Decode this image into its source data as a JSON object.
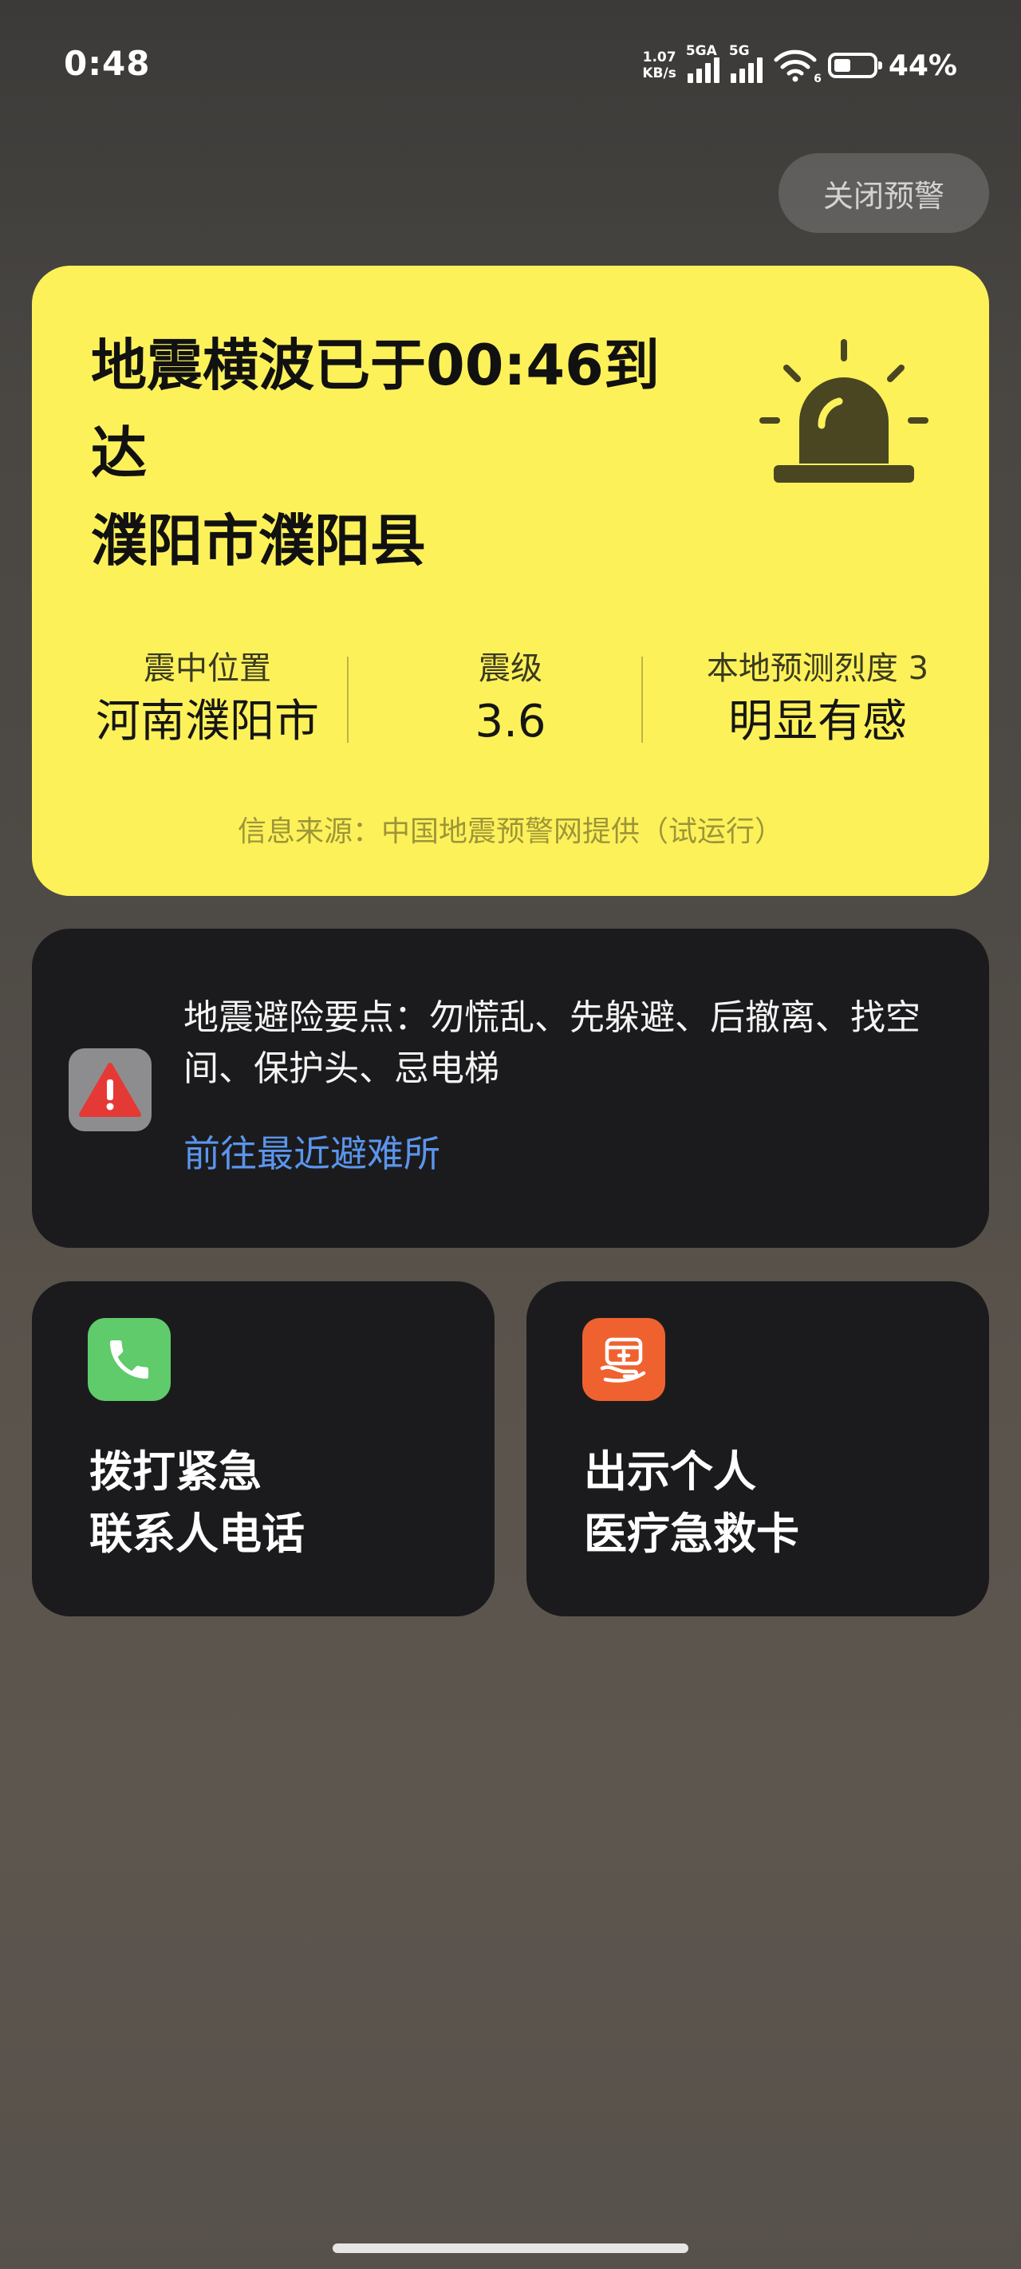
{
  "status_bar": {
    "time": "0:48",
    "net_speed_value": "1.07",
    "net_speed_unit": "KB/s",
    "sim1_tag": "5GA",
    "sim2_tag": "5G",
    "wifi_num": "6",
    "battery_pct": "44%",
    "battery_level": 0.44
  },
  "close_button_label": "关闭预警",
  "alert": {
    "title_line1": "地震横波已于00:46到",
    "title_line2": "达",
    "title_line3": "濮阳市濮阳县",
    "epicenter_label": "震中位置",
    "epicenter_value": "河南濮阳市",
    "magnitude_label": "震级",
    "magnitude_value": "3.6",
    "intensity_label": "本地预测烈度 3",
    "intensity_value": "明显有感",
    "source": "信息来源：中国地震预警网提供（试运行）",
    "card_color": "#fdf15a"
  },
  "tips": {
    "text": "地震避险要点：勿慌乱、先躲避、后撤离、找空间、保护头、忌电梯",
    "shelter_link": "前往最近避难所",
    "link_color": "#5b95ec"
  },
  "actions": {
    "call_line1": "拨打紧急",
    "call_line2": "联系人电话",
    "medical_line1": "出示个人",
    "medical_line2": "医疗急救卡"
  }
}
